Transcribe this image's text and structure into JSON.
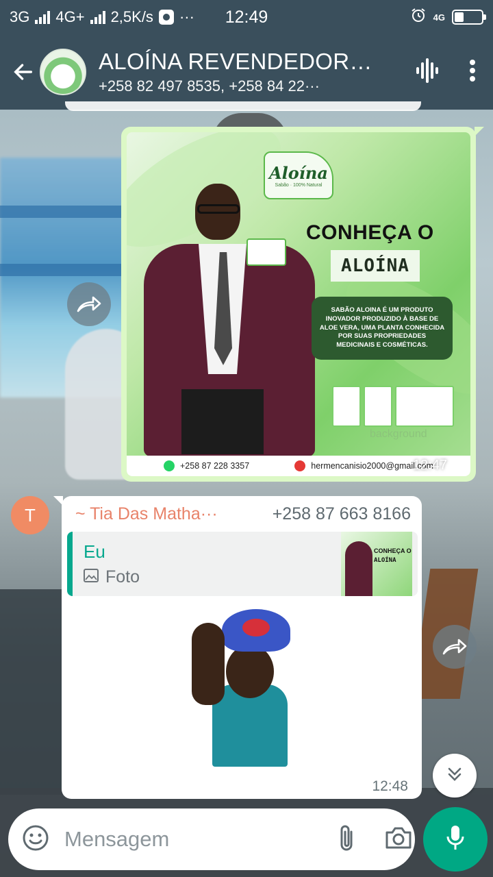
{
  "status_bar": {
    "net1": "3G",
    "net2": "4G+",
    "speed": "2,5K/s",
    "dots": "···",
    "time": "12:49",
    "net_tag": "4G"
  },
  "header": {
    "title": "ALOÍNA REVENDEDOR···",
    "subtitle": "+258 82 497 8535, +258 84 22···"
  },
  "outgoing_message": {
    "poster": {
      "brand": "Aloína",
      "brand_sub": "Sabão · 100% Natural",
      "headline": "CONHEÇA O",
      "product": "ALOÍNA",
      "description": "SABÃO ALOINA É UM PRODUTO INOVADOR PRODUZIDO À BASE DE ALOE VERA, UMA PLANTA CONHECIDA POR SUAS PROPRIEDADES MEDICINAIS E COSMÉTICAS.",
      "watermark": "background",
      "phone": "+258 87 228 3357",
      "email": "hermencanisio2000@gmail.com"
    },
    "time": "12:47",
    "status_icon": "single-check-icon"
  },
  "incoming_message": {
    "avatar_letter": "T",
    "sender_name": "~ Tia Das Matha···",
    "sender_phone": "+258 87 663 8166",
    "quote": {
      "author": "Eu",
      "type": "Foto",
      "thumb_headline": "CONHEÇA O",
      "thumb_product": "ALOÍNA"
    },
    "time": "12:48"
  },
  "composer": {
    "placeholder": "Mensagem"
  },
  "colors": {
    "bar": "#3a4f5c",
    "accent": "#00a884",
    "out_bubble": "#dcf8c6",
    "sender_name": "#e8836a"
  }
}
